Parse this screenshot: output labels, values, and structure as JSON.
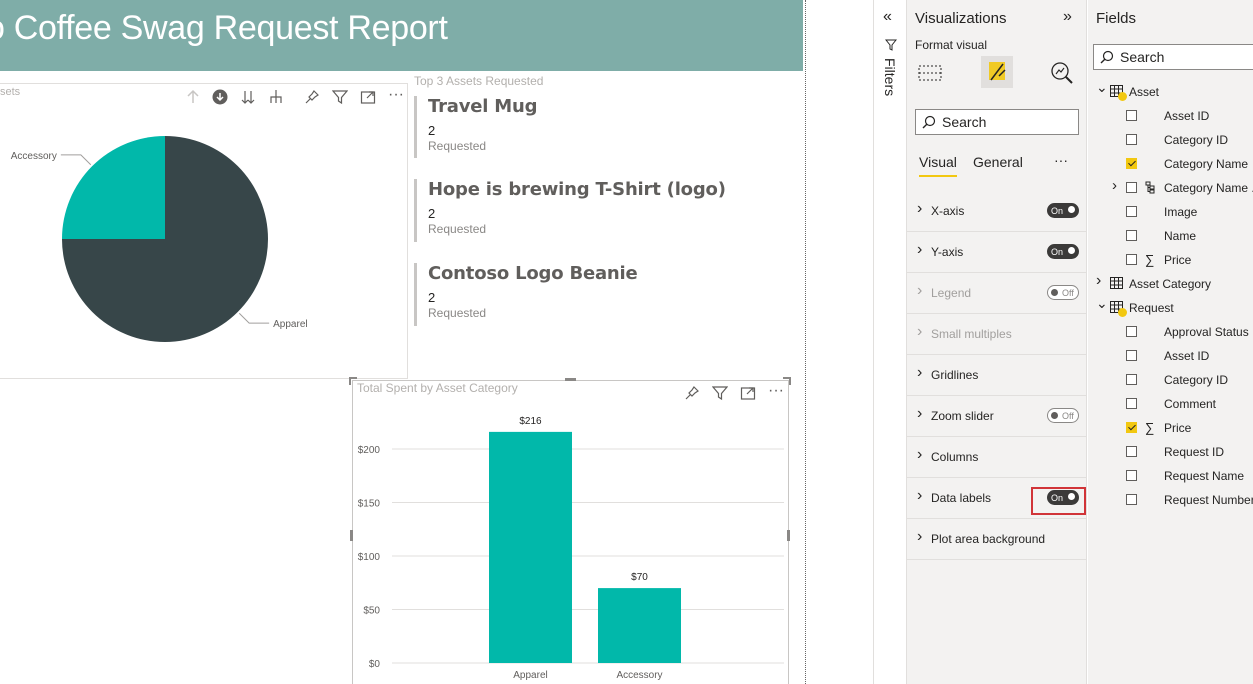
{
  "report": {
    "title": "Coffee Swag Request Report",
    "title_partial": "o Coffee Swag Request Report"
  },
  "pie_visual": {
    "title_fragment": "sets",
    "labels": [
      "Accessory",
      "Apparel"
    ]
  },
  "card_visual": {
    "title": "Top 3 Assets Requested",
    "items": [
      {
        "name": "Travel Mug",
        "value": "2",
        "sub": "Requested"
      },
      {
        "name": "Hope is brewing T-Shirt (logo)",
        "value": "2",
        "sub": "Requested"
      },
      {
        "name": "Contoso Logo Beanie",
        "value": "2",
        "sub": "Requested"
      }
    ]
  },
  "bar_visual": {
    "title": "Total Spent by Asset Category"
  },
  "chart_data": [
    {
      "type": "pie",
      "categories": [
        "Apparel",
        "Accessory"
      ],
      "values": [
        75,
        25
      ],
      "colors": [
        "#374649",
        "#01b8aa"
      ]
    },
    {
      "type": "bar",
      "title": "Total Spent by Asset Category",
      "categories": [
        "Apparel",
        "Accessory"
      ],
      "values": [
        216,
        70
      ],
      "data_labels": [
        "$216",
        "$70"
      ],
      "ylim": [
        0,
        200
      ],
      "yticks": [
        "$0",
        "$50",
        "$100",
        "$150",
        "$200"
      ],
      "color": "#01b8aa",
      "grid": true
    }
  ],
  "filters": {
    "label": "Filters"
  },
  "viz_pane": {
    "title": "Visualizations",
    "subtitle": "Format visual",
    "search_placeholder": "Search",
    "tabs": [
      "Visual",
      "General"
    ],
    "more": "···",
    "sections": [
      {
        "label": "X-axis",
        "toggle": "On",
        "disabled": false
      },
      {
        "label": "Y-axis",
        "toggle": "On",
        "disabled": false
      },
      {
        "label": "Legend",
        "toggle": "Off",
        "disabled": true
      },
      {
        "label": "Small multiples",
        "toggle": "",
        "disabled": true
      },
      {
        "label": "Gridlines",
        "toggle": "",
        "disabled": false
      },
      {
        "label": "Zoom slider",
        "toggle": "Off",
        "disabled": false
      },
      {
        "label": "Columns",
        "toggle": "",
        "disabled": false
      },
      {
        "label": "Data labels",
        "toggle": "On",
        "disabled": false
      },
      {
        "label": "Plot area background",
        "toggle": "",
        "disabled": false
      }
    ]
  },
  "fields_pane": {
    "title": "Fields",
    "search_placeholder": "Search",
    "tables": [
      {
        "name": "Asset",
        "expanded": true,
        "fields": [
          {
            "name": "Asset ID",
            "checked": false,
            "sigma": false,
            "hier": false
          },
          {
            "name": "Category ID",
            "checked": false,
            "sigma": false,
            "hier": false
          },
          {
            "name": "Category Name",
            "checked": true,
            "sigma": false,
            "hier": false
          },
          {
            "name": "Category Name ...",
            "checked": false,
            "sigma": false,
            "hier": true
          },
          {
            "name": "Image",
            "checked": false,
            "sigma": false,
            "hier": false
          },
          {
            "name": "Name",
            "checked": false,
            "sigma": false,
            "hier": false
          },
          {
            "name": "Price",
            "checked": false,
            "sigma": true,
            "hier": false
          }
        ]
      },
      {
        "name": "Asset Category",
        "expanded": false,
        "fields": []
      },
      {
        "name": "Request",
        "expanded": true,
        "fields": [
          {
            "name": "Approval Status",
            "checked": false,
            "sigma": false,
            "hier": false
          },
          {
            "name": "Asset ID",
            "checked": false,
            "sigma": false,
            "hier": false
          },
          {
            "name": "Category ID",
            "checked": false,
            "sigma": false,
            "hier": false
          },
          {
            "name": "Comment",
            "checked": false,
            "sigma": false,
            "hier": false
          },
          {
            "name": "Price",
            "checked": true,
            "sigma": true,
            "hier": false
          },
          {
            "name": "Request ID",
            "checked": false,
            "sigma": false,
            "hier": false
          },
          {
            "name": "Request Name",
            "checked": false,
            "sigma": false,
            "hier": false
          },
          {
            "name": "Request Number",
            "checked": false,
            "sigma": false,
            "hier": false
          }
        ]
      }
    ]
  },
  "colors": {
    "title_bar": "#7fada8",
    "teal": "#01b8aa",
    "dark": "#374649",
    "highlight": "#d13438",
    "checkbox_checked": "#f2c811"
  }
}
